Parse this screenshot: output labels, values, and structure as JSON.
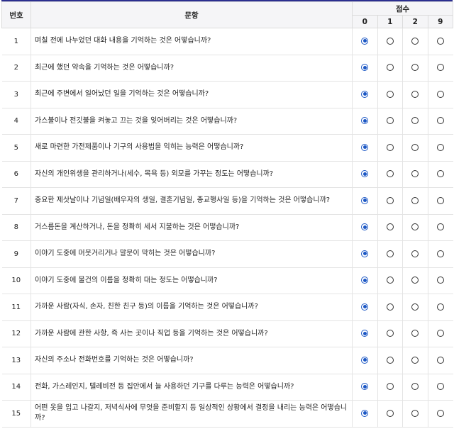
{
  "header": {
    "no_label": "번호",
    "question_label": "문항",
    "score_label": "점수",
    "score_options": [
      "0",
      "1",
      "2",
      "9"
    ]
  },
  "accent_color": "#1a56c4",
  "rows": [
    {
      "no": "1",
      "text": "며칠 전에 나누었던 대화 내용을 기억하는 것은 어떻습니까?",
      "selected": "0"
    },
    {
      "no": "2",
      "text": "최근에 했던 약속을 기억하는 것은 어떻습니까?",
      "selected": "0"
    },
    {
      "no": "3",
      "text": "최근에 주변에서 일어났던 일을 기억하는 것은 어떻습니까?",
      "selected": "0"
    },
    {
      "no": "4",
      "text": "가스불이나 전깃불을 켜놓고 끄는 것을 잊어버리는 것은 어떻습니까?",
      "selected": "0"
    },
    {
      "no": "5",
      "text": "새로 마련한 가전제품이나 기구의 사용법을 익히는 능력은 어떻습니까?",
      "selected": "0"
    },
    {
      "no": "6",
      "text": "자신의 개인위생을 관리하거나(세수, 목욕 등) 외모를 가꾸는 정도는 어떻습니까?",
      "selected": "0"
    },
    {
      "no": "7",
      "text": "중요한 제삿날이나 기념일(배우자의 생일, 결혼기념일, 종교행사일 등)을 기억하는 것은 어떻습니까?",
      "selected": "0"
    },
    {
      "no": "8",
      "text": "거스름돈을 계산하거나, 돈을 정확히 세서 지불하는 것은 어떻습니까?",
      "selected": "0"
    },
    {
      "no": "9",
      "text": "이야기 도중에 머뭇거리거나 말문이 막히는 것은 어떻습니까?",
      "selected": "0"
    },
    {
      "no": "10",
      "text": "이야기 도중에 물건의 이름을 정확히 대는 정도는 어떻습니까?",
      "selected": "0"
    },
    {
      "no": "11",
      "text": "가까운 사람(자식, 손자, 친한 친구 등)의 이름을 기억하는 것은 어떻습니까?",
      "selected": "0"
    },
    {
      "no": "12",
      "text": "가까운 사람에 관한 사항, 즉 사는 곳이나 직업 등을 기억하는 것은 어떻습니까?",
      "selected": "0"
    },
    {
      "no": "13",
      "text": "자신의 주소나 전화번호를 기억하는 것은 어떻습니까?",
      "selected": "0"
    },
    {
      "no": "14",
      "text": "전화, 가스레인지, 텔레비전 등 집안에서 늘 사용하던 기구를 다루는 능력은 어떻습니까?",
      "selected": "0"
    },
    {
      "no": "15",
      "text": "어떤 옷을 입고 나갈지, 저녁식사에 무엇을 준비할지 등 일상적인 상황에서 결정을 내리는 능력은 어떻습니까?",
      "selected": "0"
    }
  ]
}
